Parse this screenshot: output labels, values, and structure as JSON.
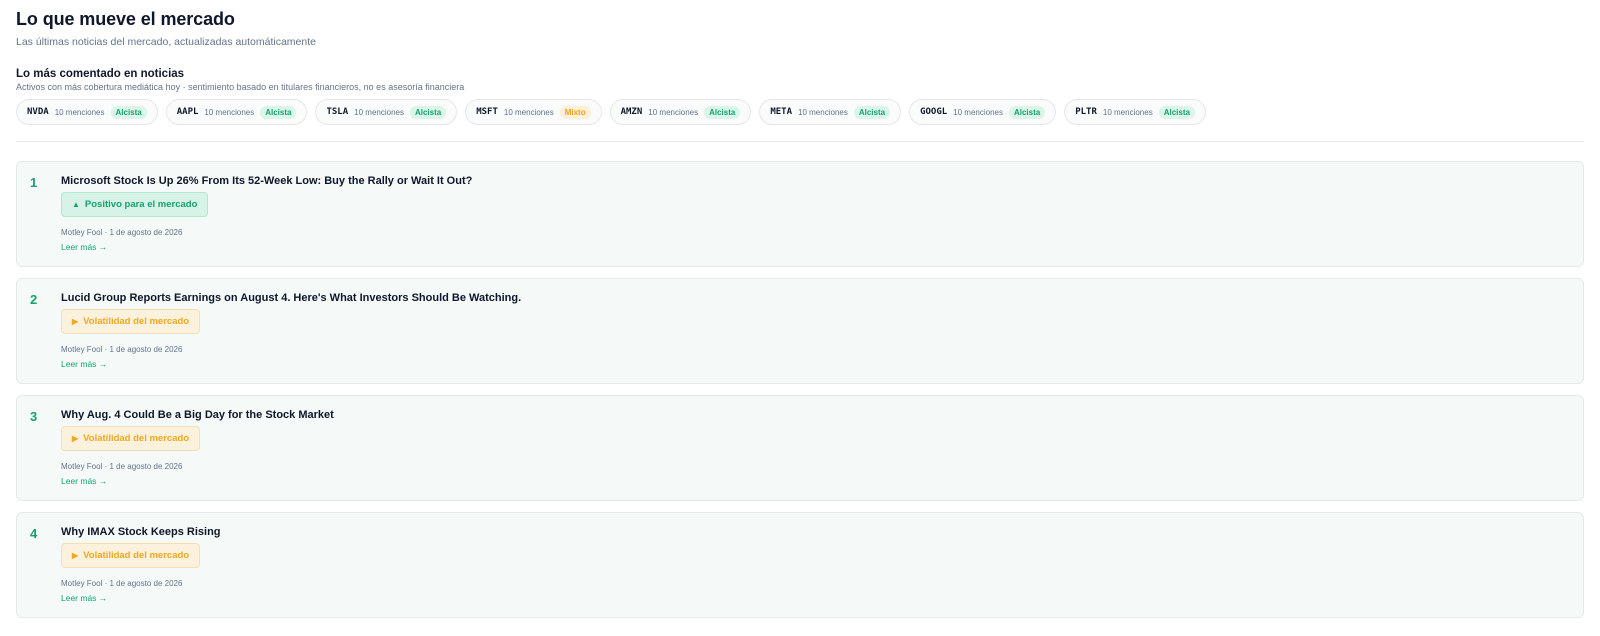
{
  "header": {
    "title": "Lo que mueve el mercado",
    "subtitle": "Las últimas noticias del mercado, actualizadas automáticamente"
  },
  "trending": {
    "title": "Lo más comentado en noticias",
    "subtitle": "Activos con más cobertura mediática hoy · sentimiento basado en titulares financieros, no es asesoría financiera",
    "chips": [
      {
        "ticker": "NVDA",
        "mentions": "10 menciones",
        "sentiment": "Alcista"
      },
      {
        "ticker": "AAPL",
        "mentions": "10 menciones",
        "sentiment": "Alcista"
      },
      {
        "ticker": "TSLA",
        "mentions": "10 menciones",
        "sentiment": "Alcista"
      },
      {
        "ticker": "MSFT",
        "mentions": "10 menciones",
        "sentiment": "Mixto"
      },
      {
        "ticker": "AMZN",
        "mentions": "10 menciones",
        "sentiment": "Alcista"
      },
      {
        "ticker": "META",
        "mentions": "10 menciones",
        "sentiment": "Alcista"
      },
      {
        "ticker": "GOOGL",
        "mentions": "10 menciones",
        "sentiment": "Alcista"
      },
      {
        "ticker": "PLTR",
        "mentions": "10 menciones",
        "sentiment": "Alcista"
      }
    ]
  },
  "news": [
    {
      "rank": "1",
      "headline": "Microsoft Stock Is Up 26% From Its 52-Week Low: Buy the Rally or Wait It Out?",
      "impact_icon": "▲",
      "impact": "Positivo para el mercado",
      "impact_type": "positive",
      "meta": "Motley Fool · 1 de agosto de 2026",
      "read_more": "Leer más →"
    },
    {
      "rank": "2",
      "headline": "Lucid Group Reports Earnings on August 4. Here's What Investors Should Be Watching.",
      "impact_icon": "▶",
      "impact": "Volatilidad del mercado",
      "impact_type": "volatility",
      "meta": "Motley Fool · 1 de agosto de 2026",
      "read_more": "Leer más →"
    },
    {
      "rank": "3",
      "headline": "Why Aug. 4 Could Be a Big Day for the Stock Market",
      "impact_icon": "▶",
      "impact": "Volatilidad del mercado",
      "impact_type": "volatility",
      "meta": "Motley Fool · 1 de agosto de 2026",
      "read_more": "Leer más →"
    },
    {
      "rank": "4",
      "headline": "Why IMAX Stock Keeps Rising",
      "impact_icon": "▶",
      "impact": "Volatilidad del mercado",
      "impact_type": "volatility",
      "meta": "Motley Fool · 1 de agosto de 2026",
      "read_more": "Leer más →"
    }
  ],
  "colors": {
    "accent_green": "#16a36d",
    "warning_amber": "#f0a820",
    "card_background": "#f5f9f8"
  }
}
